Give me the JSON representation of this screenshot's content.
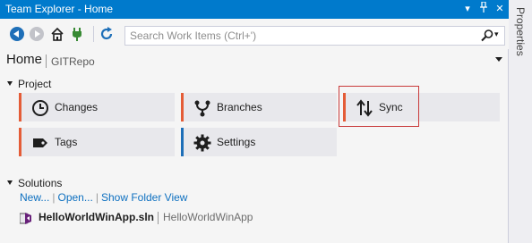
{
  "window": {
    "title": "Team Explorer - Home"
  },
  "titlebar": {
    "menu_icon": "dropdown-arrow-icon",
    "pin_icon": "pin-icon",
    "close_icon": "close-icon"
  },
  "toolbar": {
    "icons": [
      "back-arrow-icon",
      "forward-arrow-icon",
      "home-icon",
      "connect-plug-icon",
      "refresh-icon"
    ],
    "search_placeholder": "Search Work Items (Ctrl+')"
  },
  "header": {
    "title": "Home",
    "repo": "GITRepo"
  },
  "project": {
    "heading": "Project",
    "tiles": [
      {
        "label": "Changes",
        "icon": "clock-icon",
        "accent": "#e45c37"
      },
      {
        "label": "Branches",
        "icon": "branch-icon",
        "accent": "#e45c37"
      },
      {
        "label": "Sync",
        "icon": "sync-arrows-icon",
        "accent": "#e45c37"
      },
      {
        "label": "Tags",
        "icon": "tag-icon",
        "accent": "#e45c37"
      },
      {
        "label": "Settings",
        "icon": "gear-icon",
        "accent": "#1e6fb8"
      }
    ]
  },
  "solutions": {
    "heading": "Solutions",
    "links": [
      "New...",
      "Open...",
      "Show Folder View"
    ],
    "item": {
      "name": "HelloWorldWinApp.sln",
      "description": "HelloWorldWinApp"
    }
  },
  "sidebar": {
    "properties_label": "Properties"
  },
  "colors": {
    "accent_blue": "#007acc",
    "accent_red": "#e45c37",
    "highlight_red": "#c93b3b"
  }
}
